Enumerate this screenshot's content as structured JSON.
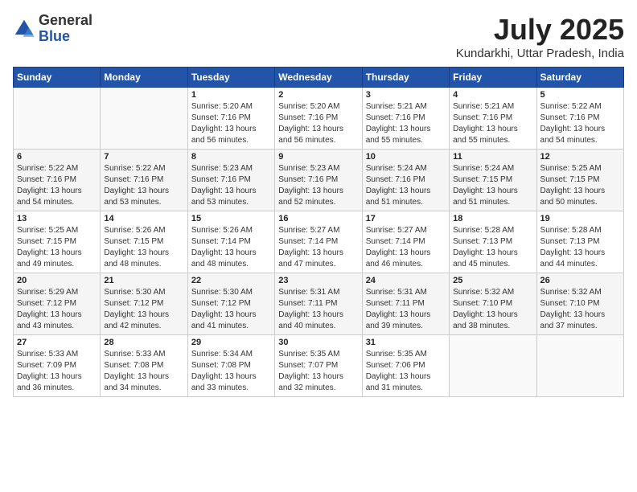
{
  "header": {
    "logo_general": "General",
    "logo_blue": "Blue",
    "month_title": "July 2025",
    "location": "Kundarkhi, Uttar Pradesh, India"
  },
  "days_of_week": [
    "Sunday",
    "Monday",
    "Tuesday",
    "Wednesday",
    "Thursday",
    "Friday",
    "Saturday"
  ],
  "weeks": [
    [
      {
        "day": "",
        "info": ""
      },
      {
        "day": "",
        "info": ""
      },
      {
        "day": "1",
        "info": "Sunrise: 5:20 AM\nSunset: 7:16 PM\nDaylight: 13 hours\nand 56 minutes."
      },
      {
        "day": "2",
        "info": "Sunrise: 5:20 AM\nSunset: 7:16 PM\nDaylight: 13 hours\nand 56 minutes."
      },
      {
        "day": "3",
        "info": "Sunrise: 5:21 AM\nSunset: 7:16 PM\nDaylight: 13 hours\nand 55 minutes."
      },
      {
        "day": "4",
        "info": "Sunrise: 5:21 AM\nSunset: 7:16 PM\nDaylight: 13 hours\nand 55 minutes."
      },
      {
        "day": "5",
        "info": "Sunrise: 5:22 AM\nSunset: 7:16 PM\nDaylight: 13 hours\nand 54 minutes."
      }
    ],
    [
      {
        "day": "6",
        "info": "Sunrise: 5:22 AM\nSunset: 7:16 PM\nDaylight: 13 hours\nand 54 minutes."
      },
      {
        "day": "7",
        "info": "Sunrise: 5:22 AM\nSunset: 7:16 PM\nDaylight: 13 hours\nand 53 minutes."
      },
      {
        "day": "8",
        "info": "Sunrise: 5:23 AM\nSunset: 7:16 PM\nDaylight: 13 hours\nand 53 minutes."
      },
      {
        "day": "9",
        "info": "Sunrise: 5:23 AM\nSunset: 7:16 PM\nDaylight: 13 hours\nand 52 minutes."
      },
      {
        "day": "10",
        "info": "Sunrise: 5:24 AM\nSunset: 7:16 PM\nDaylight: 13 hours\nand 51 minutes."
      },
      {
        "day": "11",
        "info": "Sunrise: 5:24 AM\nSunset: 7:15 PM\nDaylight: 13 hours\nand 51 minutes."
      },
      {
        "day": "12",
        "info": "Sunrise: 5:25 AM\nSunset: 7:15 PM\nDaylight: 13 hours\nand 50 minutes."
      }
    ],
    [
      {
        "day": "13",
        "info": "Sunrise: 5:25 AM\nSunset: 7:15 PM\nDaylight: 13 hours\nand 49 minutes."
      },
      {
        "day": "14",
        "info": "Sunrise: 5:26 AM\nSunset: 7:15 PM\nDaylight: 13 hours\nand 48 minutes."
      },
      {
        "day": "15",
        "info": "Sunrise: 5:26 AM\nSunset: 7:14 PM\nDaylight: 13 hours\nand 48 minutes."
      },
      {
        "day": "16",
        "info": "Sunrise: 5:27 AM\nSunset: 7:14 PM\nDaylight: 13 hours\nand 47 minutes."
      },
      {
        "day": "17",
        "info": "Sunrise: 5:27 AM\nSunset: 7:14 PM\nDaylight: 13 hours\nand 46 minutes."
      },
      {
        "day": "18",
        "info": "Sunrise: 5:28 AM\nSunset: 7:13 PM\nDaylight: 13 hours\nand 45 minutes."
      },
      {
        "day": "19",
        "info": "Sunrise: 5:28 AM\nSunset: 7:13 PM\nDaylight: 13 hours\nand 44 minutes."
      }
    ],
    [
      {
        "day": "20",
        "info": "Sunrise: 5:29 AM\nSunset: 7:12 PM\nDaylight: 13 hours\nand 43 minutes."
      },
      {
        "day": "21",
        "info": "Sunrise: 5:30 AM\nSunset: 7:12 PM\nDaylight: 13 hours\nand 42 minutes."
      },
      {
        "day": "22",
        "info": "Sunrise: 5:30 AM\nSunset: 7:12 PM\nDaylight: 13 hours\nand 41 minutes."
      },
      {
        "day": "23",
        "info": "Sunrise: 5:31 AM\nSunset: 7:11 PM\nDaylight: 13 hours\nand 40 minutes."
      },
      {
        "day": "24",
        "info": "Sunrise: 5:31 AM\nSunset: 7:11 PM\nDaylight: 13 hours\nand 39 minutes."
      },
      {
        "day": "25",
        "info": "Sunrise: 5:32 AM\nSunset: 7:10 PM\nDaylight: 13 hours\nand 38 minutes."
      },
      {
        "day": "26",
        "info": "Sunrise: 5:32 AM\nSunset: 7:10 PM\nDaylight: 13 hours\nand 37 minutes."
      }
    ],
    [
      {
        "day": "27",
        "info": "Sunrise: 5:33 AM\nSunset: 7:09 PM\nDaylight: 13 hours\nand 36 minutes."
      },
      {
        "day": "28",
        "info": "Sunrise: 5:33 AM\nSunset: 7:08 PM\nDaylight: 13 hours\nand 34 minutes."
      },
      {
        "day": "29",
        "info": "Sunrise: 5:34 AM\nSunset: 7:08 PM\nDaylight: 13 hours\nand 33 minutes."
      },
      {
        "day": "30",
        "info": "Sunrise: 5:35 AM\nSunset: 7:07 PM\nDaylight: 13 hours\nand 32 minutes."
      },
      {
        "day": "31",
        "info": "Sunrise: 5:35 AM\nSunset: 7:06 PM\nDaylight: 13 hours\nand 31 minutes."
      },
      {
        "day": "",
        "info": ""
      },
      {
        "day": "",
        "info": ""
      }
    ]
  ]
}
